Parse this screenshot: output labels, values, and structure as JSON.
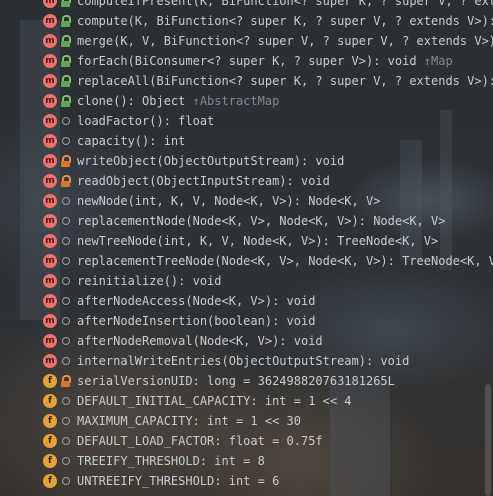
{
  "members": [
    {
      "kind": "m",
      "vis": "pub",
      "text": "computeIfPresent(K, BiFunction<? super K, ? super V, ? exte",
      "src": ""
    },
    {
      "kind": "m",
      "vis": "pub",
      "text": "compute(K, BiFunction<? super K, ? super V, ? extends V>): V",
      "src": ""
    },
    {
      "kind": "m",
      "vis": "pub",
      "text": "merge(K, V, BiFunction<? super V, ? super V, ? extends V>): V",
      "src": ""
    },
    {
      "kind": "m",
      "vis": "pub",
      "text": "forEach(BiConsumer<? super K, ? super V>): void",
      "src": "↑Map"
    },
    {
      "kind": "m",
      "vis": "pub",
      "text": "replaceAll(BiFunction<? super K, ? super V, ? extends V>): vo",
      "src": ""
    },
    {
      "kind": "m",
      "vis": "pub",
      "text": "clone(): Object",
      "src": "↑AbstractMap"
    },
    {
      "kind": "m",
      "vis": "pkg",
      "text": "loadFactor(): float",
      "src": ""
    },
    {
      "kind": "m",
      "vis": "pkg",
      "text": "capacity(): int",
      "src": ""
    },
    {
      "kind": "m",
      "vis": "prv",
      "text": "writeObject(ObjectOutputStream): void",
      "src": ""
    },
    {
      "kind": "m",
      "vis": "prv",
      "text": "readObject(ObjectInputStream): void",
      "src": ""
    },
    {
      "kind": "m",
      "vis": "pkg",
      "text": "newNode(int, K, V, Node<K, V>): Node<K, V>",
      "src": ""
    },
    {
      "kind": "m",
      "vis": "pkg",
      "text": "replacementNode(Node<K, V>, Node<K, V>): Node<K, V>",
      "src": ""
    },
    {
      "kind": "m",
      "vis": "pkg",
      "text": "newTreeNode(int, K, V, Node<K, V>): TreeNode<K, V>",
      "src": ""
    },
    {
      "kind": "m",
      "vis": "pkg",
      "text": "replacementTreeNode(Node<K, V>, Node<K, V>): TreeNode<K, V>",
      "src": ""
    },
    {
      "kind": "m",
      "vis": "pkg",
      "text": "reinitialize(): void",
      "src": ""
    },
    {
      "kind": "m",
      "vis": "pkg",
      "text": "afterNodeAccess(Node<K, V>): void",
      "src": ""
    },
    {
      "kind": "m",
      "vis": "pkg",
      "text": "afterNodeInsertion(boolean): void",
      "src": ""
    },
    {
      "kind": "m",
      "vis": "pkg",
      "text": "afterNodeRemoval(Node<K, V>): void",
      "src": ""
    },
    {
      "kind": "m",
      "vis": "pkg",
      "text": "internalWriteEntries(ObjectOutputStream): void",
      "src": ""
    },
    {
      "kind": "f",
      "vis": "prv",
      "text": "serialVersionUID: long = 362498820763181265L",
      "src": ""
    },
    {
      "kind": "f",
      "vis": "pkg",
      "text": "DEFAULT_INITIAL_CAPACITY: int = 1 << 4",
      "src": ""
    },
    {
      "kind": "f",
      "vis": "pkg",
      "text": "MAXIMUM_CAPACITY: int = 1 << 30",
      "src": ""
    },
    {
      "kind": "f",
      "vis": "pkg",
      "text": "DEFAULT_LOAD_FACTOR: float = 0.75f",
      "src": ""
    },
    {
      "kind": "f",
      "vis": "pkg",
      "text": "TREEIFY_THRESHOLD: int = 8",
      "src": ""
    },
    {
      "kind": "f",
      "vis": "pkg",
      "text": "UNTREEIFY_THRESHOLD: int = 6",
      "src": ""
    }
  ],
  "icon_letters": {
    "m": "m",
    "f": "f"
  },
  "colors": {
    "method": "#f26f6a",
    "field": "#e3a23a",
    "public": "#67a556",
    "private": "#d9752f"
  }
}
